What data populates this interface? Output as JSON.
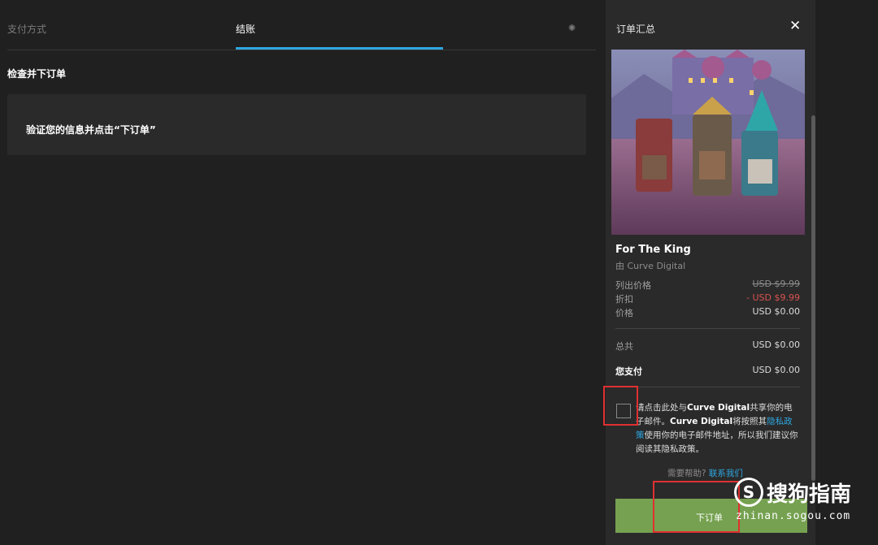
{
  "tabs": {
    "payment": "支付方式",
    "checkout": "结账"
  },
  "checkout": {
    "heading": "检查并下订单",
    "verify_text": "验证您的信息并点击“下订单”"
  },
  "summary": {
    "title": "订单汇总",
    "game_title": "For The King",
    "publisher": "由 Curve Digital",
    "list_price_label": "列出价格",
    "list_price_value": "USD $9.99",
    "discount_label": "折扣",
    "discount_value": "- USD $9.99",
    "price_label": "价格",
    "price_value": "USD $0.00",
    "total_label": "总共",
    "total_value": "USD $0.00",
    "you_pay_label": "您支付",
    "you_pay_value": "USD $0.00"
  },
  "consent": {
    "part1": "请点击此处与",
    "brand1": "Curve Digital",
    "part2": "共享你的电子邮件。",
    "brand2": "Curve Digital",
    "part3": "将按照其",
    "link": "隐私政策",
    "part4": "使用你的电子邮件地址，所以我们建议你阅读其隐私政策。"
  },
  "help": {
    "text": "需要帮助?",
    "link": "联系我们"
  },
  "order_button": "下订单",
  "watermark": {
    "icon": "S",
    "main": "搜狗指南",
    "sub": "zhinan.sogou.com"
  },
  "colors": {
    "accent": "#2ea6e0",
    "order_button": "#75a150",
    "discount": "#d9534f",
    "highlight": "#e03030"
  },
  "icons": [
    "close-icon",
    "settings-icon"
  ]
}
